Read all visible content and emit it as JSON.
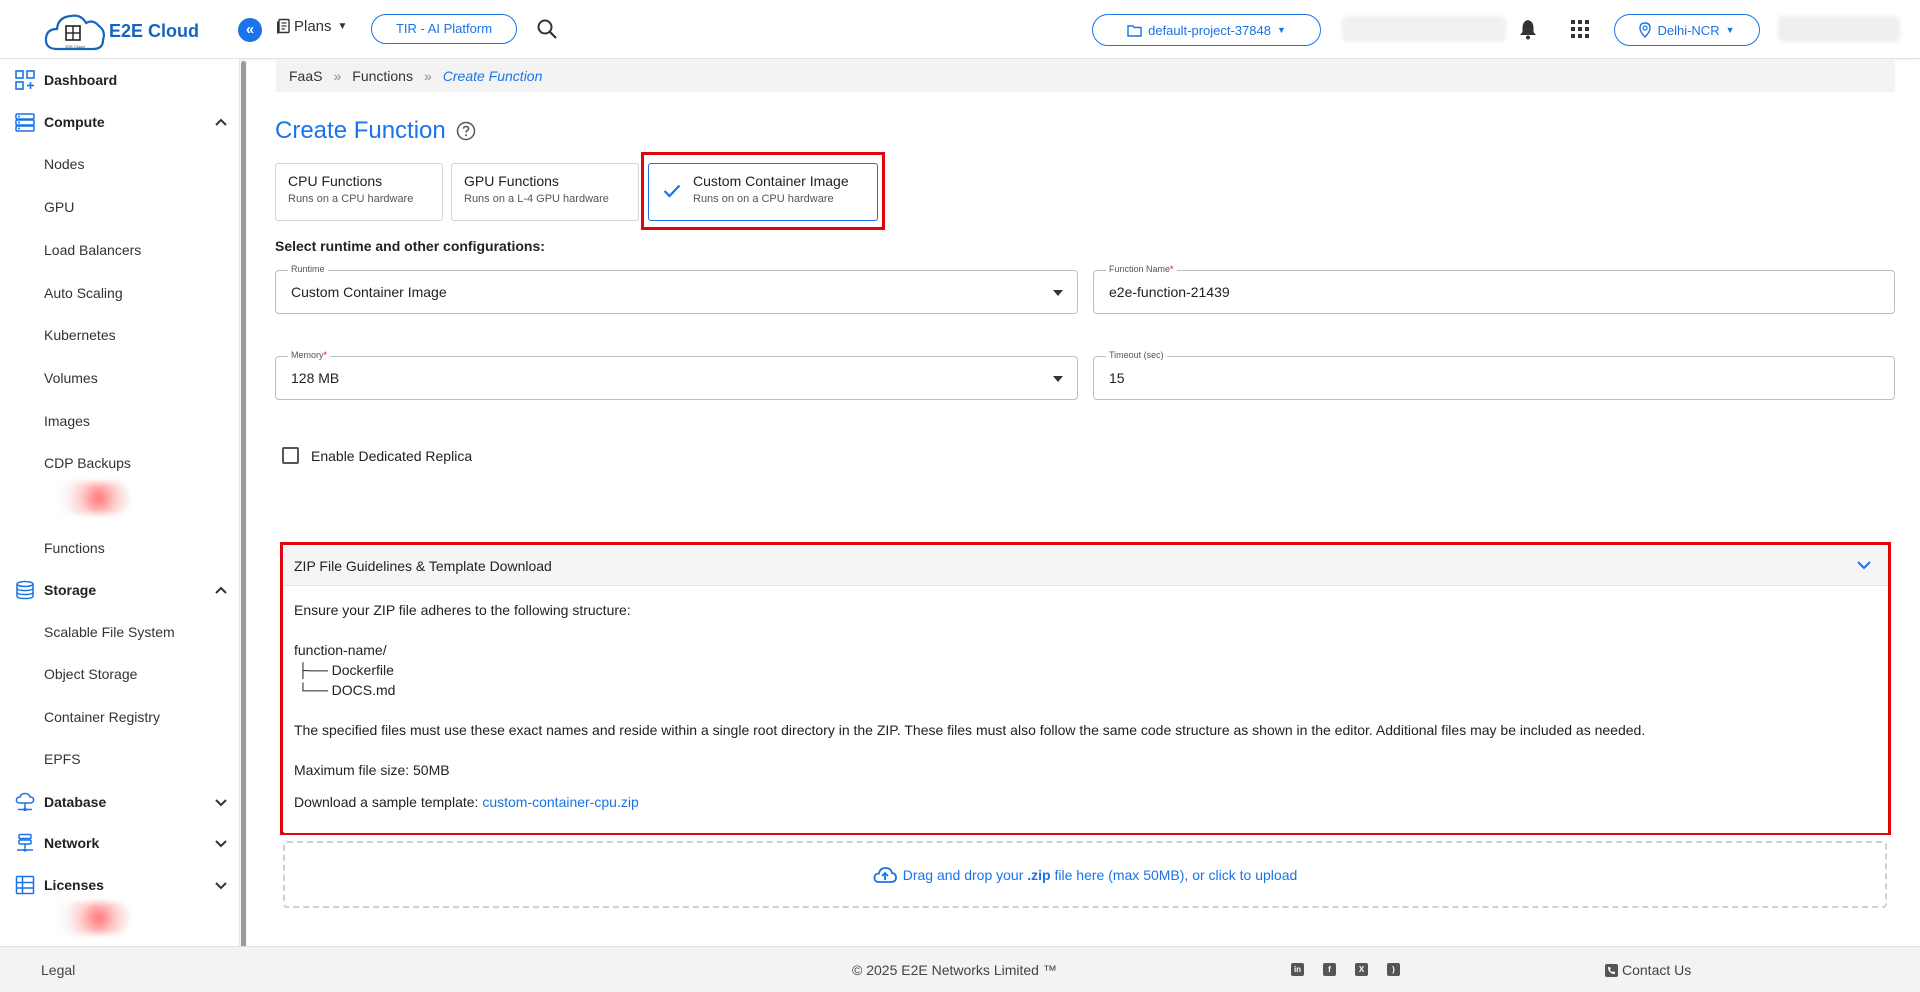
{
  "header": {
    "logo_text": "E2E Cloud",
    "logo_sub": "E2E Cloud",
    "collapse_icon": "«",
    "plans_label": "Plans",
    "tir_label": "TIR - AI Platform",
    "project_label": "default-project-37848",
    "region_label": "Delhi-NCR"
  },
  "sidebar": {
    "dashboard": "Dashboard",
    "compute": "Compute",
    "compute_items": [
      "Nodes",
      "GPU",
      "Load Balancers",
      "Auto Scaling",
      "Kubernetes",
      "Volumes",
      "Images",
      "CDP Backups",
      "Functions"
    ],
    "storage": "Storage",
    "storage_items": [
      "Scalable File System",
      "Object Storage",
      "Container Registry",
      "EPFS"
    ],
    "database": "Database",
    "network": "Network",
    "licenses": "Licenses"
  },
  "breadcrumb": {
    "items": [
      "FaaS",
      "Functions",
      "Create Function"
    ],
    "separator": "»"
  },
  "page": {
    "title": "Create Function",
    "cards": [
      {
        "title": "CPU Functions",
        "subtitle": "Runs on a CPU hardware"
      },
      {
        "title": "GPU Functions",
        "subtitle": "Runs on a L-4 GPU hardware"
      },
      {
        "title": "Custom Container Image",
        "subtitle": "Runs on on a CPU hardware"
      }
    ],
    "config_label": "Select runtime and other configurations:",
    "runtime": {
      "label": "Runtime",
      "value": "Custom Container Image"
    },
    "function_name": {
      "label": "Function Name",
      "required": "*",
      "value": "e2e-function-21439"
    },
    "memory": {
      "label": "Memory",
      "required": "*",
      "value": "128 MB"
    },
    "timeout": {
      "label": "Timeout (sec)",
      "value": "15"
    },
    "dedicated_replica_label": "Enable Dedicated Replica"
  },
  "zip": {
    "header": "ZIP File Guidelines & Template Download",
    "intro": "Ensure your ZIP file adheres to the following structure:",
    "tree": [
      "function-name/",
      "├── Dockerfile",
      "└── DOCS.md"
    ],
    "note": "The specified files must use these exact names and reside within a single root directory in the ZIP. These files must also follow the same code structure as shown in the editor. Additional files may be included as needed.",
    "max_size": "Maximum file size: 50MB",
    "download_prefix": "Download a sample template: ",
    "download_link": "custom-container-cpu.zip"
  },
  "dropzone": {
    "prefix": "Drag and drop your ",
    "ext": ".zip",
    "suffix": " file here (max 50MB), or click to upload"
  },
  "footer": {
    "legal": "Legal",
    "copyright": "© 2025 E2E Networks Limited ™",
    "socials": [
      "linkedin-icon",
      "facebook-icon",
      "x-icon",
      "rss-icon"
    ],
    "contact": "Contact Us"
  },
  "colors": {
    "accent": "#1a73e8",
    "highlight_border": "#e0060c"
  }
}
